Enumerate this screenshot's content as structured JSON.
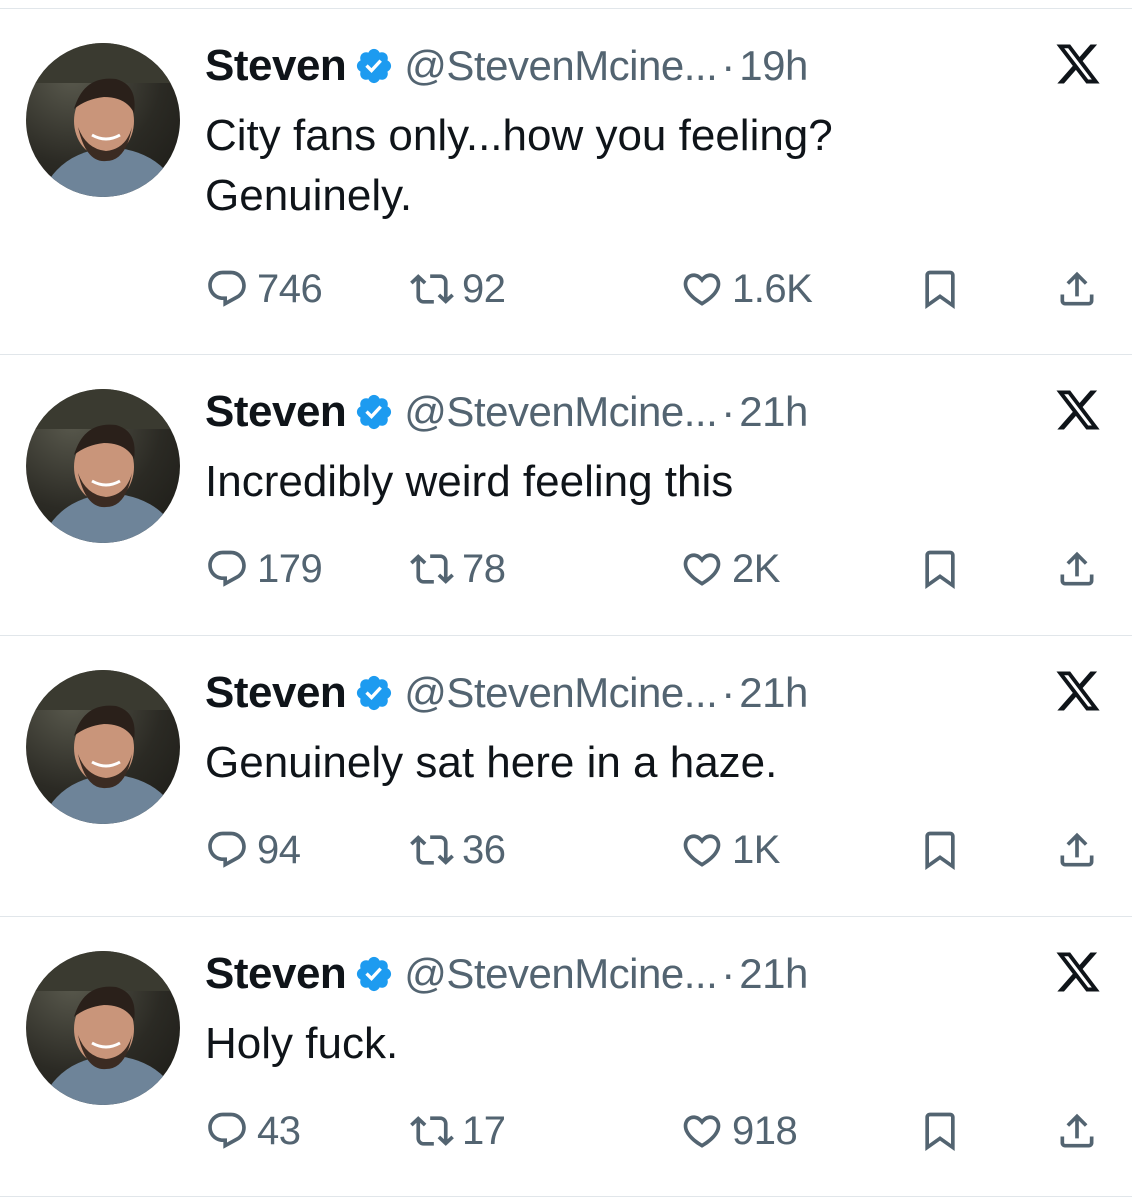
{
  "colors": {
    "text": "#0f1419",
    "muted": "#536471",
    "verified": "#1d9bf0",
    "divider": "#e1e6ea"
  },
  "icons": {
    "reply": "reply-icon",
    "retweet": "retweet-icon",
    "like": "heart-icon",
    "bookmark": "bookmark-icon",
    "share": "share-icon",
    "verified": "verified-badge-icon",
    "platform": "x-logo-icon"
  },
  "tweets": [
    {
      "name": "Steven",
      "handle": "@StevenMcine...",
      "separator": "·",
      "time": "19h",
      "lines": [
        "City fans only...how you feeling?",
        "Genuinely."
      ],
      "replies": "746",
      "retweets": "92",
      "likes": "1.6K"
    },
    {
      "name": "Steven",
      "handle": "@StevenMcine...",
      "separator": "·",
      "time": "21h",
      "lines": [
        "Incredibly weird feeling this"
      ],
      "replies": "179",
      "retweets": "78",
      "likes": "2K"
    },
    {
      "name": "Steven",
      "handle": "@StevenMcine...",
      "separator": "·",
      "time": "21h",
      "lines": [
        "Genuinely sat here in a haze."
      ],
      "replies": "94",
      "retweets": "36",
      "likes": "1K"
    },
    {
      "name": "Steven",
      "handle": "@StevenMcine...",
      "separator": "·",
      "time": "21h",
      "lines": [
        "Holy fuck."
      ],
      "replies": "43",
      "retweets": "17",
      "likes": "918"
    }
  ]
}
